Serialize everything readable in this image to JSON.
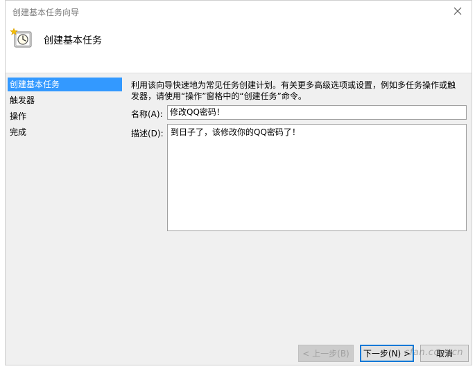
{
  "window": {
    "title": "创建基本任务向导",
    "header_title": "创建基本任务"
  },
  "sidebar": {
    "items": [
      {
        "label": "创建基本任务",
        "active": true
      },
      {
        "label": "触发器",
        "active": false
      },
      {
        "label": "操作",
        "active": false
      },
      {
        "label": "完成",
        "active": false
      }
    ]
  },
  "main": {
    "intro": "利用该向导快速地为常见任务创建计划。有关更多高级选项或设置，例如多任务操作或触发器，请使用“操作”窗格中的“创建任务”命令。",
    "name_label": "名称(A):",
    "name_value": "修改QQ密码！",
    "desc_label": "描述(D):",
    "desc_value": "到日子了，该修改你的QQ密码了！"
  },
  "buttons": {
    "back": "< 上一步(B)",
    "next": "下一步(N) >",
    "cancel": "取消"
  },
  "watermark": "cfan.com.cn",
  "colors": {
    "selection": "#3399ff",
    "panel": "#f0f0f0",
    "focus_border": "#0078d7"
  }
}
